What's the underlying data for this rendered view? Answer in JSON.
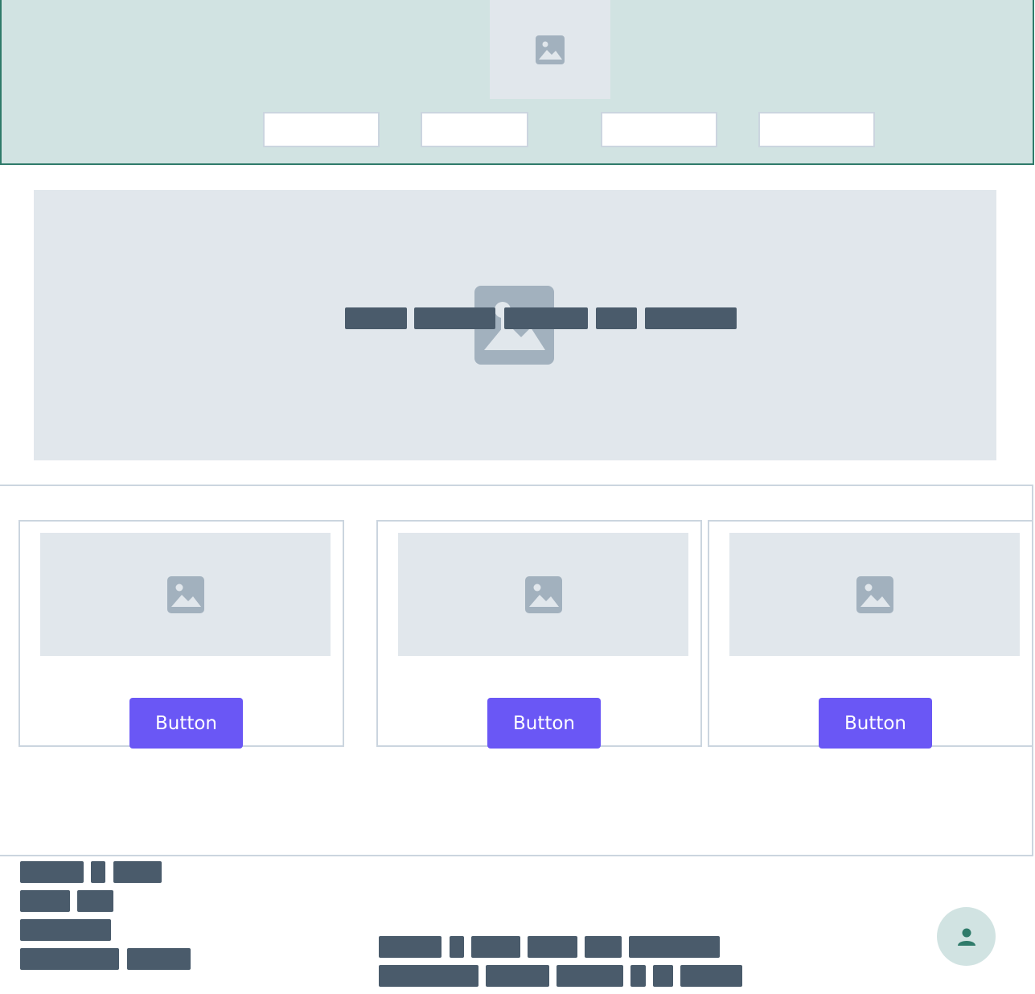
{
  "header": {
    "logo_icon": "image-placeholder-icon",
    "nav_items": [
      "",
      "",
      "",
      ""
    ]
  },
  "hero": {
    "image_icon": "image-placeholder-icon",
    "text_placeholder": "redacted text"
  },
  "cards": [
    {
      "image_icon": "image-placeholder-icon",
      "button_label": "Button"
    },
    {
      "image_icon": "image-placeholder-icon",
      "button_label": "Button"
    },
    {
      "image_icon": "image-placeholder-icon",
      "button_label": "Button"
    }
  ],
  "footer": {
    "avatar_icon": "user-icon"
  },
  "colors": {
    "header_bg": "#d1e3e2",
    "header_border": "#2f7b6a",
    "placeholder_bg": "#e1e7ec",
    "icon_gray": "#a2b1be",
    "text_bar": "#4a5b6b",
    "button_bg": "#6a57f5",
    "border": "#cbd5df",
    "avatar_icon": "#2f7b6a"
  }
}
